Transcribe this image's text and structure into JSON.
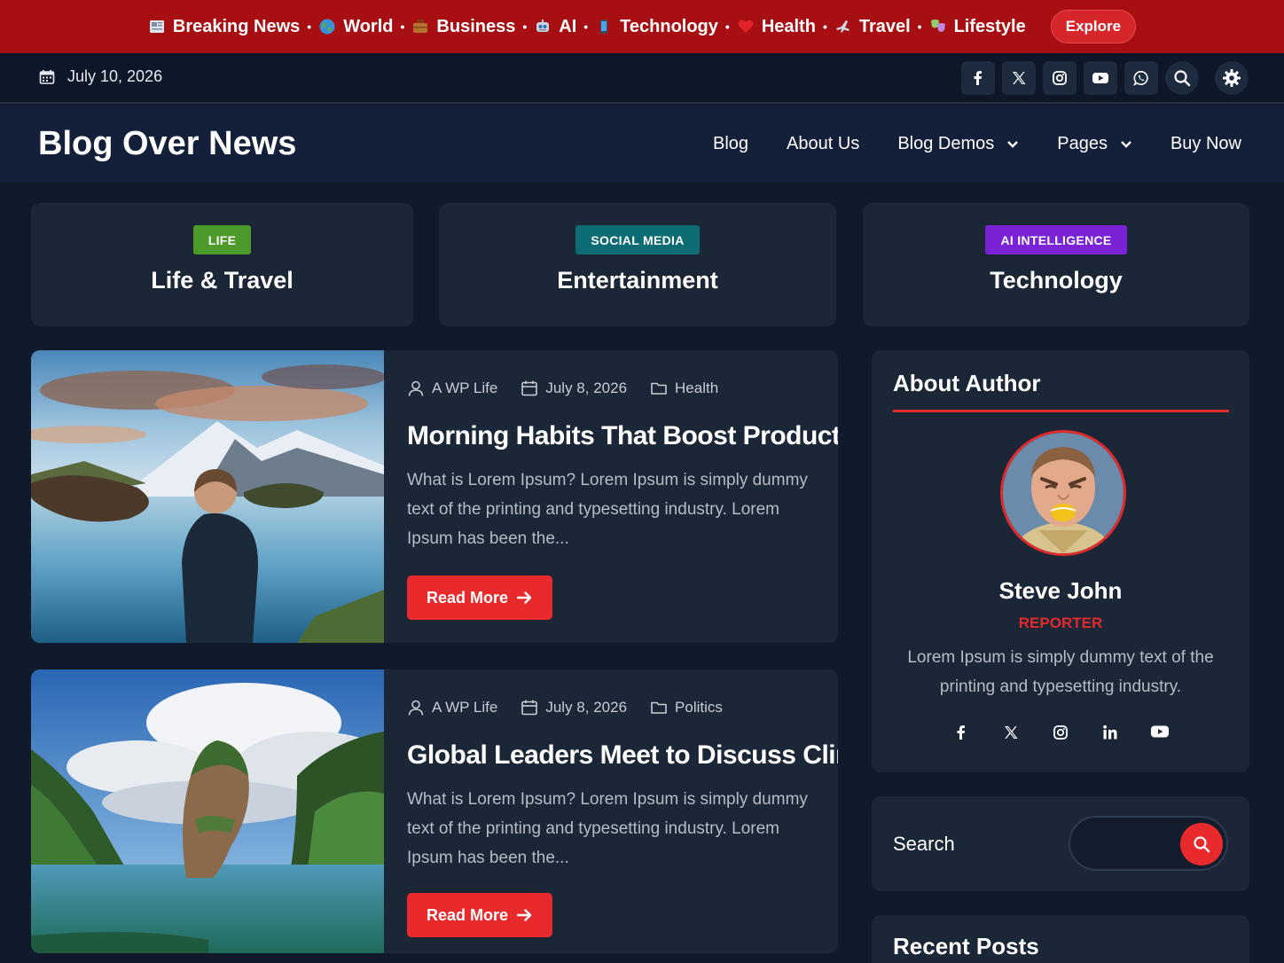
{
  "ticker": {
    "items": [
      {
        "label": "Breaking News",
        "icon": "newspaper-icon"
      },
      {
        "label": "World",
        "icon": "globe-icon"
      },
      {
        "label": "Business",
        "icon": "briefcase-icon"
      },
      {
        "label": "AI",
        "icon": "robot-icon"
      },
      {
        "label": "Technology",
        "icon": "phone-icon"
      },
      {
        "label": "Health",
        "icon": "heart-icon"
      },
      {
        "label": "Travel",
        "icon": "airplane-icon"
      },
      {
        "label": "Lifestyle",
        "icon": "masks-icon"
      }
    ],
    "separator": "•",
    "explore_label": "Explore"
  },
  "infobar": {
    "date": "July 10, 2026",
    "social_icons": [
      "facebook-icon",
      "x-icon",
      "instagram-icon",
      "youtube-icon",
      "whatsapp-icon"
    ]
  },
  "header": {
    "site_title": "Blog Over News",
    "nav": {
      "blog": "Blog",
      "about": "About Us",
      "demos": "Blog Demos",
      "pages": "Pages",
      "buy": "Buy Now"
    }
  },
  "categories": [
    {
      "badge": "LIFE",
      "title": "Life & Travel",
      "badge_color": "#4c9a2a"
    },
    {
      "badge": "SOCIAL MEDIA",
      "title": "Entertainment",
      "badge_color": "#0d6b73"
    },
    {
      "badge": "AI INTELLIGENCE",
      "title": "Technology",
      "badge_color": "#7a22d6"
    }
  ],
  "posts": [
    {
      "author": "A WP Life",
      "date": "July 8, 2026",
      "category": "Health",
      "title": "Morning Habits That Boost Productivity",
      "excerpt": "What is Lorem Ipsum? Lorem Ipsum is simply dummy text of the printing and typesetting industry. Lorem Ipsum has been the...",
      "read_more": "Read More"
    },
    {
      "author": "A WP Life",
      "date": "July 8, 2026",
      "category": "Politics",
      "title": "Global Leaders Meet to Discuss Climate",
      "excerpt": "What is Lorem Ipsum? Lorem Ipsum is simply dummy text of the printing and typesetting industry. Lorem Ipsum has been the...",
      "read_more": "Read More"
    }
  ],
  "sidebar": {
    "about_title": "About Author",
    "author_name": "Steve John",
    "author_role": "REPORTER",
    "author_bio": "Lorem Ipsum is simply dummy text of the printing and typesetting industry.",
    "author_social_icons": [
      "facebook-icon",
      "x-icon",
      "instagram-icon",
      "linkedin-icon",
      "youtube-icon"
    ],
    "search_label": "Search",
    "search_placeholder": "",
    "recent_title": "Recent Posts"
  },
  "colors": {
    "accent_red": "#e82a2c",
    "topbar_red": "#a70f12",
    "page_bg": "#101a2b",
    "card_bg": "#1b2637"
  }
}
